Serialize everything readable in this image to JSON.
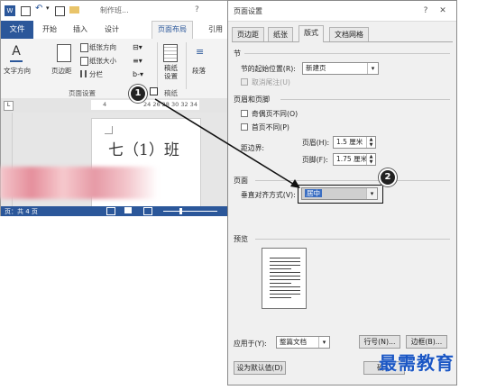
{
  "word": {
    "title_fragment": "制作班...",
    "help": "?",
    "tabs": {
      "file": "文件",
      "home": "开始",
      "insert": "插入",
      "design": "设计",
      "layout": "页面布局",
      "references": "引用"
    },
    "ribbon": {
      "text_direction": "文字方向",
      "margins": "页边距",
      "orientation": "纸张方向",
      "size": "纸张大小",
      "columns": "分栏",
      "manuscript": "稿纸\n设置",
      "paragraph": "段落",
      "group_page_setup": "页面设置",
      "group_manuscript": "稿纸"
    },
    "ruler_numbers": "24 26 28 30 32 34",
    "ruler_left": "4",
    "page_text": "七（1）班",
    "status_left": "页：共 4 页"
  },
  "dialog": {
    "title": "页面设置",
    "help": "?",
    "close": "✕",
    "tabs": [
      "页边距",
      "纸张",
      "版式",
      "文档网格"
    ],
    "active_tab": 2,
    "section_label": "节",
    "section_start_label": "节的起始位置(R):",
    "section_start_value": "新建页",
    "suppress_endnotes": "取消尾注(U)",
    "headers_footers_label": "页眉和页脚",
    "odd_even": "奇偶页不同(O)",
    "first_page": "首页不同(P)",
    "from_edge": "距边界:",
    "header_label": "页眉(H):",
    "header_value": "1.5 厘米",
    "footer_label": "页脚(F):",
    "footer_value": "1.75 厘米",
    "page_label": "页面",
    "vertical_align_label": "垂直对齐方式(V):",
    "vertical_align_value": "居中",
    "preview_label": "预览",
    "apply_to_label": "应用于(Y):",
    "apply_to_value": "整篇文档",
    "line_numbers_button": "行号(N)...",
    "borders_button": "边框(B)...",
    "default_button": "设为默认值(D)",
    "ok_button": "确"
  },
  "callouts": [
    "1",
    "2"
  ],
  "watermark": "最需教育",
  "colors": {
    "word_blue": "#2b579a",
    "watermark": "#1a56c4"
  }
}
